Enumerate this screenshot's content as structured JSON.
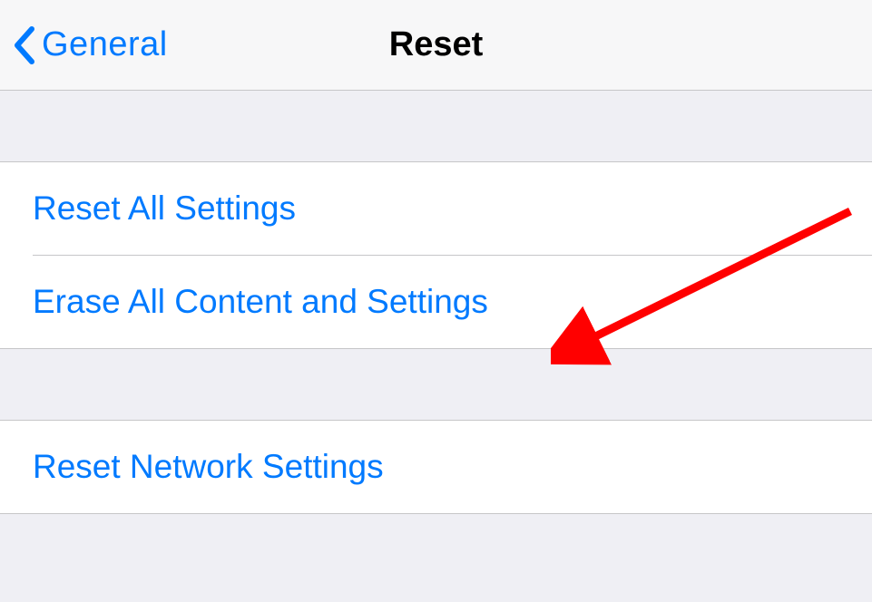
{
  "nav": {
    "back_label": "General",
    "title": "Reset"
  },
  "groups": [
    {
      "items": [
        {
          "label": "Reset All Settings"
        },
        {
          "label": "Erase All Content and Settings"
        }
      ]
    },
    {
      "items": [
        {
          "label": "Reset Network Settings"
        }
      ]
    }
  ],
  "colors": {
    "accent": "#007aff",
    "arrow": "#ff0000"
  }
}
